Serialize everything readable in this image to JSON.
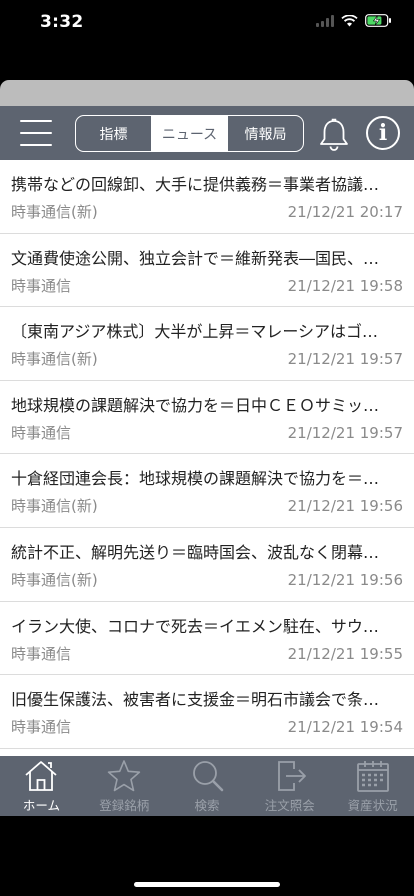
{
  "status": {
    "time": "3:32"
  },
  "nav": {
    "tabs": [
      {
        "label": "指標",
        "active": false
      },
      {
        "label": "ニュース",
        "active": true
      },
      {
        "label": "情報局",
        "active": false
      }
    ],
    "info_glyph": "i"
  },
  "news": [
    {
      "title": "携帯などの回線卸、大手に提供義務＝事業者協議…",
      "source": "時事通信(新)",
      "date": "21/12/21 20:17"
    },
    {
      "title": "文通費使途公開、独立会計で＝維新発表―国民、…",
      "source": "時事通信",
      "date": "21/12/21 19:58"
    },
    {
      "title": "〔東南アジア株式〕大半が上昇＝マレーシアはゴ…",
      "source": "時事通信(新)",
      "date": "21/12/21 19:57"
    },
    {
      "title": "地球規模の課題解決で協力を＝日中ＣＥＯサミッ…",
      "source": "時事通信",
      "date": "21/12/21 19:57"
    },
    {
      "title": "十倉経団連会長：地球規模の課題解決で協力を＝…",
      "source": "時事通信(新)",
      "date": "21/12/21 19:56"
    },
    {
      "title": "統計不正、解明先送り＝臨時国会、波乱なく閉幕…",
      "source": "時事通信(新)",
      "date": "21/12/21 19:56"
    },
    {
      "title": "イラン大使、コロナで死去＝イエメン駐在、サウ…",
      "source": "時事通信",
      "date": "21/12/21 19:55"
    },
    {
      "title": "旧優生保護法、被害者に支援金＝明石市議会で条…",
      "source": "時事通信",
      "date": "21/12/21 19:54"
    }
  ],
  "tabbar": [
    {
      "label": "ホーム",
      "icon": "home-icon",
      "active": true
    },
    {
      "label": "登録銘柄",
      "icon": "star-icon",
      "active": false
    },
    {
      "label": "検索",
      "icon": "search-icon",
      "active": false
    },
    {
      "label": "注文照会",
      "icon": "order-icon",
      "active": false
    },
    {
      "label": "資産状況",
      "icon": "calendar-icon",
      "active": false
    }
  ]
}
